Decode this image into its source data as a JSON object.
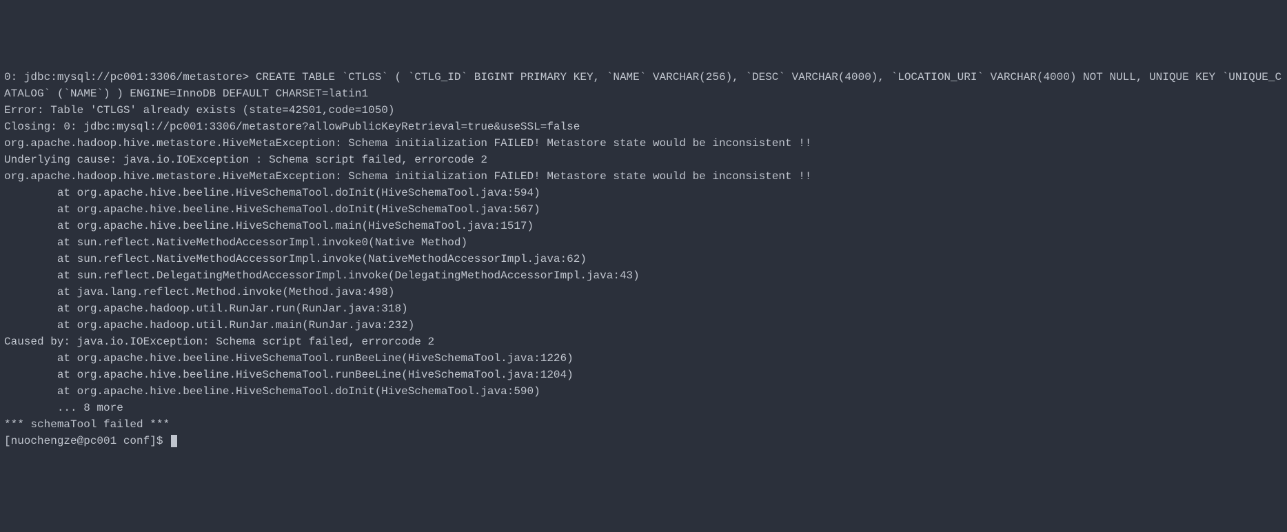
{
  "terminal": {
    "lines": [
      "0: jdbc:mysql://pc001:3306/metastore> CREATE TABLE `CTLGS` ( `CTLG_ID` BIGINT PRIMARY KEY, `NAME` VARCHAR(256), `DESC` VARCHAR(4000), `LOCATION_URI` VARCHAR(4000) NOT NULL, UNIQUE KEY `UNIQUE_CATALOG` (`NAME`) ) ENGINE=InnoDB DEFAULT CHARSET=latin1",
      "Error: Table 'CTLGS' already exists (state=42S01,code=1050)",
      "Closing: 0: jdbc:mysql://pc001:3306/metastore?allowPublicKeyRetrieval=true&useSSL=false",
      "org.apache.hadoop.hive.metastore.HiveMetaException: Schema initialization FAILED! Metastore state would be inconsistent !!",
      "Underlying cause: java.io.IOException : Schema script failed, errorcode 2",
      "org.apache.hadoop.hive.metastore.HiveMetaException: Schema initialization FAILED! Metastore state would be inconsistent !!",
      "        at org.apache.hive.beeline.HiveSchemaTool.doInit(HiveSchemaTool.java:594)",
      "        at org.apache.hive.beeline.HiveSchemaTool.doInit(HiveSchemaTool.java:567)",
      "        at org.apache.hive.beeline.HiveSchemaTool.main(HiveSchemaTool.java:1517)",
      "        at sun.reflect.NativeMethodAccessorImpl.invoke0(Native Method)",
      "        at sun.reflect.NativeMethodAccessorImpl.invoke(NativeMethodAccessorImpl.java:62)",
      "        at sun.reflect.DelegatingMethodAccessorImpl.invoke(DelegatingMethodAccessorImpl.java:43)",
      "        at java.lang.reflect.Method.invoke(Method.java:498)",
      "        at org.apache.hadoop.util.RunJar.run(RunJar.java:318)",
      "        at org.apache.hadoop.util.RunJar.main(RunJar.java:232)",
      "Caused by: java.io.IOException: Schema script failed, errorcode 2",
      "        at org.apache.hive.beeline.HiveSchemaTool.runBeeLine(HiveSchemaTool.java:1226)",
      "        at org.apache.hive.beeline.HiveSchemaTool.runBeeLine(HiveSchemaTool.java:1204)",
      "        at org.apache.hive.beeline.HiveSchemaTool.doInit(HiveSchemaTool.java:590)",
      "        ... 8 more",
      "*** schemaTool failed ***"
    ],
    "prompt": "[nuochengze@pc001 conf]$ "
  }
}
